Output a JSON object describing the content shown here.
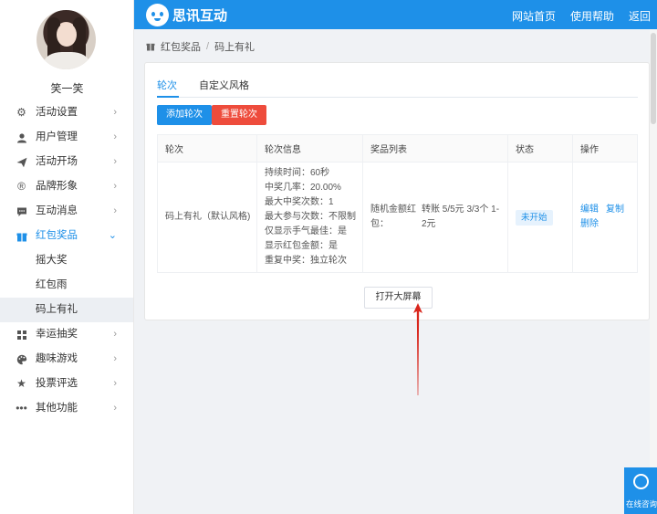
{
  "user": {
    "name": "笑一笑"
  },
  "menu": [
    {
      "label": "活动设置",
      "icon": "gear-icon"
    },
    {
      "label": "用户管理",
      "icon": "user-icon"
    },
    {
      "label": "活动开场",
      "icon": "send-icon"
    },
    {
      "label": "品牌形象",
      "icon": "registered-icon"
    },
    {
      "label": "互动消息",
      "icon": "message-icon"
    },
    {
      "label": "红包奖品",
      "icon": "gift-icon",
      "active": true,
      "children": [
        "摇大奖",
        "红包雨",
        "码上有礼"
      ]
    },
    {
      "label": "幸运抽奖",
      "icon": "grid-icon"
    },
    {
      "label": "趣味游戏",
      "icon": "palette-icon"
    },
    {
      "label": "投票评选",
      "icon": "star-icon"
    },
    {
      "label": "其他功能",
      "icon": "more-icon"
    }
  ],
  "header": {
    "brand": "思讯互动",
    "nav": [
      "网站首页",
      "使用帮助",
      "返回"
    ]
  },
  "breadcrumb": [
    "红包奖品",
    "码上有礼"
  ],
  "tabs": [
    "轮次",
    "自定义风格"
  ],
  "buttons": {
    "add": "添加轮次",
    "reset": "重置轮次",
    "open_screen": "打开大屏幕"
  },
  "table": {
    "headers": [
      "轮次",
      "轮次信息",
      "奖品列表",
      "状态",
      "操作"
    ],
    "row": {
      "round": "码上有礼（默认风格)",
      "info": [
        "持续时间：60秒",
        "中奖几率：20.00%",
        "最大中奖次数：1",
        "最大参与次数：不限制",
        "仅显示手气最佳：是",
        "显示红包金额：是",
        "重复中奖：独立轮次"
      ],
      "prize_type": "随机金额红包：",
      "prize_detail": "转账 5/5元 3/3个 1-2元",
      "status": "未开始",
      "ops": [
        "编辑",
        "复制",
        "删除"
      ]
    }
  },
  "float_help": {
    "label": "在线咨询"
  },
  "colors": {
    "primary": "#1e90e8",
    "danger": "#ee4c3c",
    "arrow": "#d9261c"
  }
}
